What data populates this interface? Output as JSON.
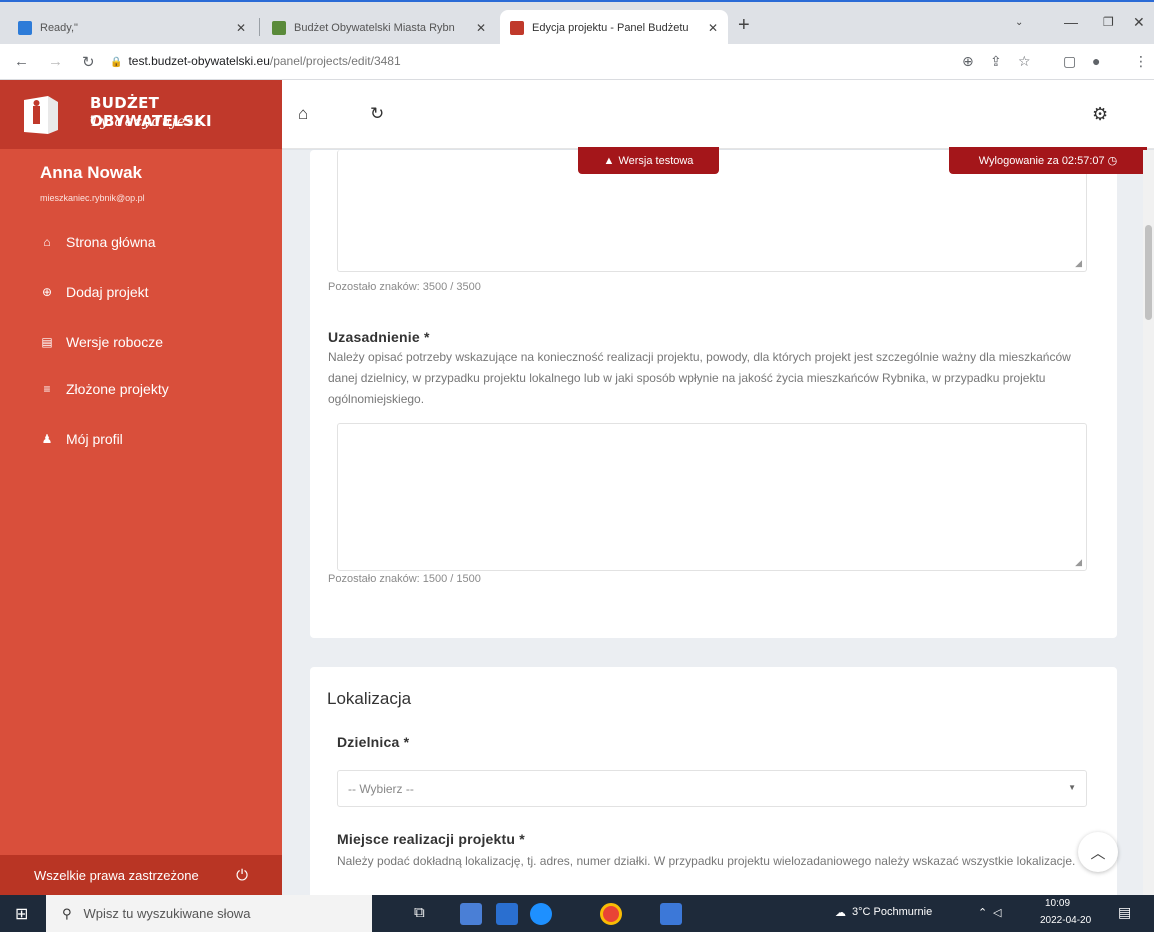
{
  "browser": {
    "tabs": [
      {
        "title": "Ready,\"",
        "favicon_color": "#2d7bd8",
        "active": false
      },
      {
        "title": "Budżet Obywatelski Miasta Rybn",
        "favicon_color": "#5a8a3a",
        "active": false
      },
      {
        "title": "Edycja projektu - Panel Budżetu",
        "favicon_color": "#c0392b",
        "active": true
      }
    ],
    "new_tab_icon": "+",
    "url_host": "test.budzet-obywatelski.eu",
    "url_path": "/panel/projects/edit/3481"
  },
  "sidebar": {
    "brand_title": "BUDŻET OBYWATELSKI",
    "brand_subtitle": "Ty decydujesz",
    "user_name": "Anna Nowak",
    "user_email": "mieszkaniec.rybnik@op.pl",
    "menu": [
      {
        "label": "Strona główna",
        "icon": "home-icon"
      },
      {
        "label": "Dodaj projekt",
        "icon": "plus-circle-icon"
      },
      {
        "label": "Wersje robocze",
        "icon": "file-icon"
      },
      {
        "label": "Złożone projekty",
        "icon": "list-icon"
      },
      {
        "label": "Mój profil",
        "icon": "user-icon"
      }
    ],
    "footer_text": "Wszelkie prawa zastrzeżone"
  },
  "topbar": {
    "test_badge": "Wersja testowa",
    "logout_label": "Wylogowanie za",
    "logout_time": "02:57:07"
  },
  "form": {
    "first_counter": "Pozostało znaków: 3500 / 3500",
    "justification_label": "Uzasadnienie *",
    "justification_help": "Należy opisać potrzeby wskazujące na konieczność realizacji projektu, powody, dla których projekt jest szczególnie ważny dla mieszkańców danej dzielnicy, w przypadku projektu lokalnego lub w jaki sposób wpłynie na jakość życia mieszkańców Rybnika, w przypadku projektu ogólnomiejskiego.",
    "justification_counter": "Pozostało znaków: 1500 / 1500",
    "location_title": "Lokalizacja",
    "district_label": "Dzielnica *",
    "district_value": "-- Wybierz --",
    "place_label": "Miejsce realizacji projektu *",
    "place_help": "Należy podać dokładną lokalizację, tj. adres, numer działki. W przypadku projektu wielozadaniowego należy wskazać wszystkie lokalizacje."
  },
  "taskbar": {
    "search_placeholder": "Wpisz tu wyszukiwane słowa",
    "weather": "3°C Pochmurnie",
    "time": "10:09",
    "date": "2022-04-20"
  },
  "colors": {
    "sidebar": "#d94f3b",
    "brand_bg": "#c0392b",
    "badge": "#a4161a"
  }
}
